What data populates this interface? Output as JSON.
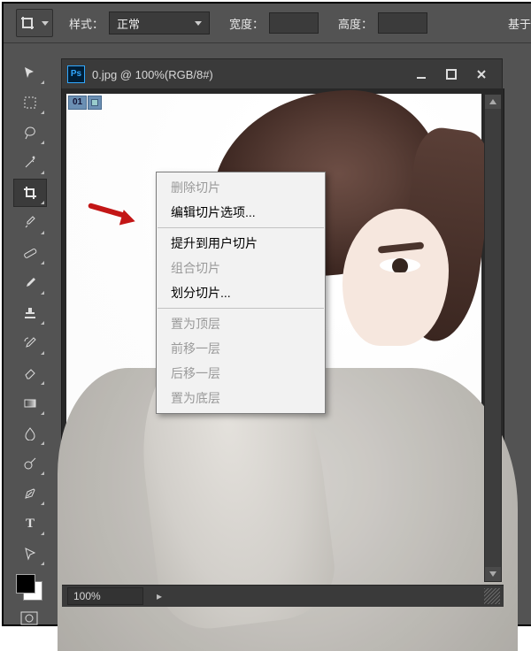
{
  "optionsBar": {
    "styleLabel": "样式：",
    "styleValue": "正常",
    "widthLabel": "宽度：",
    "heightLabel": "高度：",
    "basedOnLabel": "基于"
  },
  "docWindow": {
    "title": "0.jpg @ 100%(RGB/8#)",
    "psBadge": "Ps",
    "sliceNumber": "01"
  },
  "statusBar": {
    "zoom": "100%"
  },
  "contextMenu": {
    "items": [
      {
        "label": "删除切片",
        "enabled": false
      },
      {
        "label": "编辑切片选项...",
        "enabled": true
      },
      {
        "sep": true
      },
      {
        "label": "提升到用户切片",
        "enabled": true
      },
      {
        "label": "组合切片",
        "enabled": false
      },
      {
        "label": "划分切片...",
        "enabled": true
      },
      {
        "sep": true
      },
      {
        "label": "置为顶层",
        "enabled": false
      },
      {
        "label": "前移一层",
        "enabled": false
      },
      {
        "label": "后移一层",
        "enabled": false
      },
      {
        "label": "置为底层",
        "enabled": false
      }
    ]
  },
  "tools": [
    {
      "name": "move-tool"
    },
    {
      "name": "marquee-tool"
    },
    {
      "name": "lasso-tool"
    },
    {
      "name": "magic-wand-tool"
    },
    {
      "name": "crop-tool",
      "selected": true
    },
    {
      "name": "eyedropper-tool"
    },
    {
      "name": "healing-brush-tool"
    },
    {
      "name": "brush-tool"
    },
    {
      "name": "clone-stamp-tool"
    },
    {
      "name": "history-brush-tool"
    },
    {
      "name": "eraser-tool"
    },
    {
      "name": "gradient-tool"
    },
    {
      "name": "blur-tool"
    },
    {
      "name": "dodge-tool"
    },
    {
      "name": "pen-tool"
    },
    {
      "name": "type-tool"
    },
    {
      "name": "path-selection-tool"
    }
  ]
}
